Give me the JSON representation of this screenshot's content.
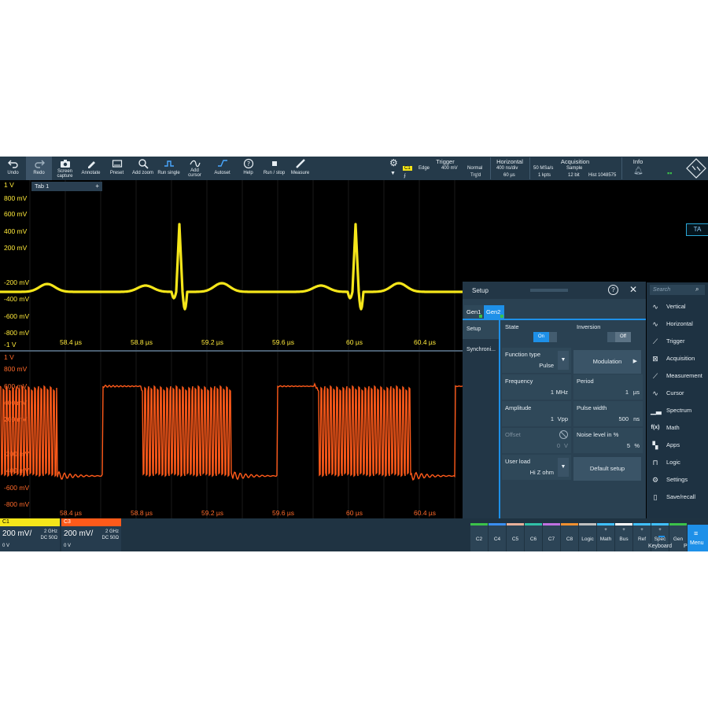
{
  "toolbar": {
    "buttons": [
      {
        "label": "Undo",
        "icon": "undo-icon"
      },
      {
        "label": "Redo",
        "icon": "redo-icon"
      },
      {
        "label": "Screen capture",
        "label2": "capture",
        "label1": "Screen",
        "icon": "camera-icon"
      },
      {
        "label": "Annotate",
        "icon": "pen-icon"
      },
      {
        "label": "Preset",
        "icon": "preset-icon"
      },
      {
        "label": "Add zoom",
        "icon": "zoom-icon"
      },
      {
        "label": "Run single",
        "icon": "run-single-icon"
      },
      {
        "label1": "Add",
        "label2": "cursor",
        "icon": "cursor-icon"
      },
      {
        "label": "Autoset",
        "icon": "autoset-icon"
      },
      {
        "label": "Help",
        "icon": "help-icon"
      },
      {
        "label": "Run / stop",
        "icon": "stop-icon"
      },
      {
        "label": "Measure",
        "icon": "ruler-icon"
      }
    ],
    "trigger": {
      "title": "Trigger",
      "source": "C1",
      "type": "Edge",
      "level": "400 mV",
      "mode": "Normal",
      "state": "Trg'd"
    },
    "horizontal": {
      "title": "Horizontal",
      "scale": "400 ns/div",
      "position": "60 µs"
    },
    "acquisition": {
      "title": "Acquisition",
      "rate": "50 MSa/s",
      "points": "1 kpts",
      "mode": "Sample",
      "bits": "12 bit",
      "hist": "Hist 1048575"
    },
    "info": {
      "title": "Info"
    }
  },
  "tab": {
    "label": "Tab 1",
    "add": "+"
  },
  "plot": {
    "upper_y_labels": [
      "1 V",
      "800 mV",
      "600 mV",
      "400 mV",
      "200 mV",
      "-200 mV",
      "-400 mV",
      "-600 mV",
      "-800 mV",
      "-1 V"
    ],
    "lower_y_labels": [
      "1 V",
      "800 mV",
      "600 mV",
      "400 mV",
      "200 mV",
      "-200 mV",
      "-400 mV",
      "-600 mV",
      "-800 mV"
    ],
    "x_labels": [
      "58.4 µs",
      "58.8 µs",
      "59.2 µs",
      "59.6 µs",
      "60 µs",
      "60.4 µs"
    ],
    "trigger_marker": "TA"
  },
  "channels": [
    {
      "name": "C1",
      "scale": "200 mV/",
      "bw": "2 GHz",
      "coupling": "DC 50Ω",
      "offset": "0 V",
      "color": "#f5e61a"
    },
    {
      "name": "C3",
      "scale": "200 mV/",
      "bw": "2 GHz",
      "coupling": "DC 50Ω",
      "offset": "0 V",
      "color": "#ff5a1a"
    }
  ],
  "channel_buttons": [
    {
      "label": "C2",
      "color": "#3cc24a"
    },
    {
      "label": "C4",
      "color": "#3a8ef0"
    },
    {
      "label": "C5",
      "color": "#e8b09a"
    },
    {
      "label": "C6",
      "color": "#30c0a8"
    },
    {
      "label": "C7",
      "color": "#c070e0"
    },
    {
      "label": "C8",
      "color": "#f09030"
    },
    {
      "label": "Logic",
      "color": "#c0c0c0"
    },
    {
      "label": "Math",
      "color": "#40c0ff",
      "plus": "+"
    },
    {
      "label": "Bus",
      "color": "#ffffff",
      "plus": "+"
    },
    {
      "label": "Ref",
      "color": "#40c0ff",
      "plus": "+"
    },
    {
      "label": "Spec",
      "color": "#40c0ff",
      "plus": "+"
    },
    {
      "label": "Gen",
      "color": "#3cc24a"
    }
  ],
  "menu": {
    "search_placeholder": "Search",
    "items": [
      "Vertical",
      "Horizontal",
      "Trigger",
      "Acquisition",
      "Measurement",
      "Cursor",
      "Spectrum",
      "Math",
      "Apps",
      "Logic",
      "Settings",
      "Save/recall"
    ],
    "keyboard": "Keyboard",
    "power": "Power",
    "menu": "Menu"
  },
  "dialog": {
    "title": "Setup",
    "tabs": [
      "Gen1",
      "Gen2"
    ],
    "left_items": [
      "Setup",
      "Synchroni..."
    ],
    "state": {
      "label": "State",
      "value": "On"
    },
    "inversion": {
      "label": "Inversion",
      "value": "Off"
    },
    "function_type": {
      "label": "Function type",
      "value": "Pulse"
    },
    "modulation": "Modulation",
    "frequency": {
      "label": "Frequency",
      "value": "1",
      "unit": "MHz"
    },
    "period": {
      "label": "Period",
      "value": "1",
      "unit": "µs"
    },
    "amplitude": {
      "label": "Amplitude",
      "value": "1",
      "unit": "Vpp"
    },
    "pulse_width": {
      "label": "Pulse width",
      "value": "500",
      "unit": "ns"
    },
    "offset": {
      "label": "Offset",
      "value": "0",
      "unit": "V"
    },
    "noise": {
      "label": "Noise level in %",
      "value": "5",
      "unit": "%"
    },
    "user_load": {
      "label": "User load",
      "value": "Hi Z ohm"
    },
    "default_setup": "Default setup"
  },
  "colors": {
    "ch1": "#f5e61a",
    "ch3": "#ff5a1a",
    "toolbar": "#253a4a",
    "accent": "#1e90e8"
  }
}
